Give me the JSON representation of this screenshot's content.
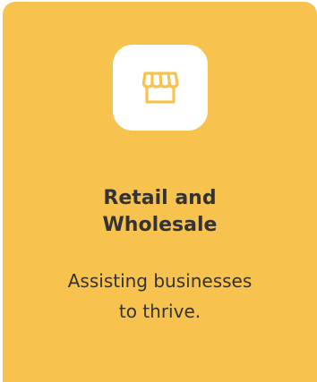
{
  "card": {
    "title_line1": "Retail and",
    "title_line2": "Wholesale",
    "description_line1": "Assisting businesses",
    "description_line2": "to thrive.",
    "icon": "storefront-icon"
  },
  "colors": {
    "card_background": "#f8c24e",
    "icon_tile": "#ffffff",
    "icon_stroke": "#f8c24e",
    "text": "#333333"
  }
}
